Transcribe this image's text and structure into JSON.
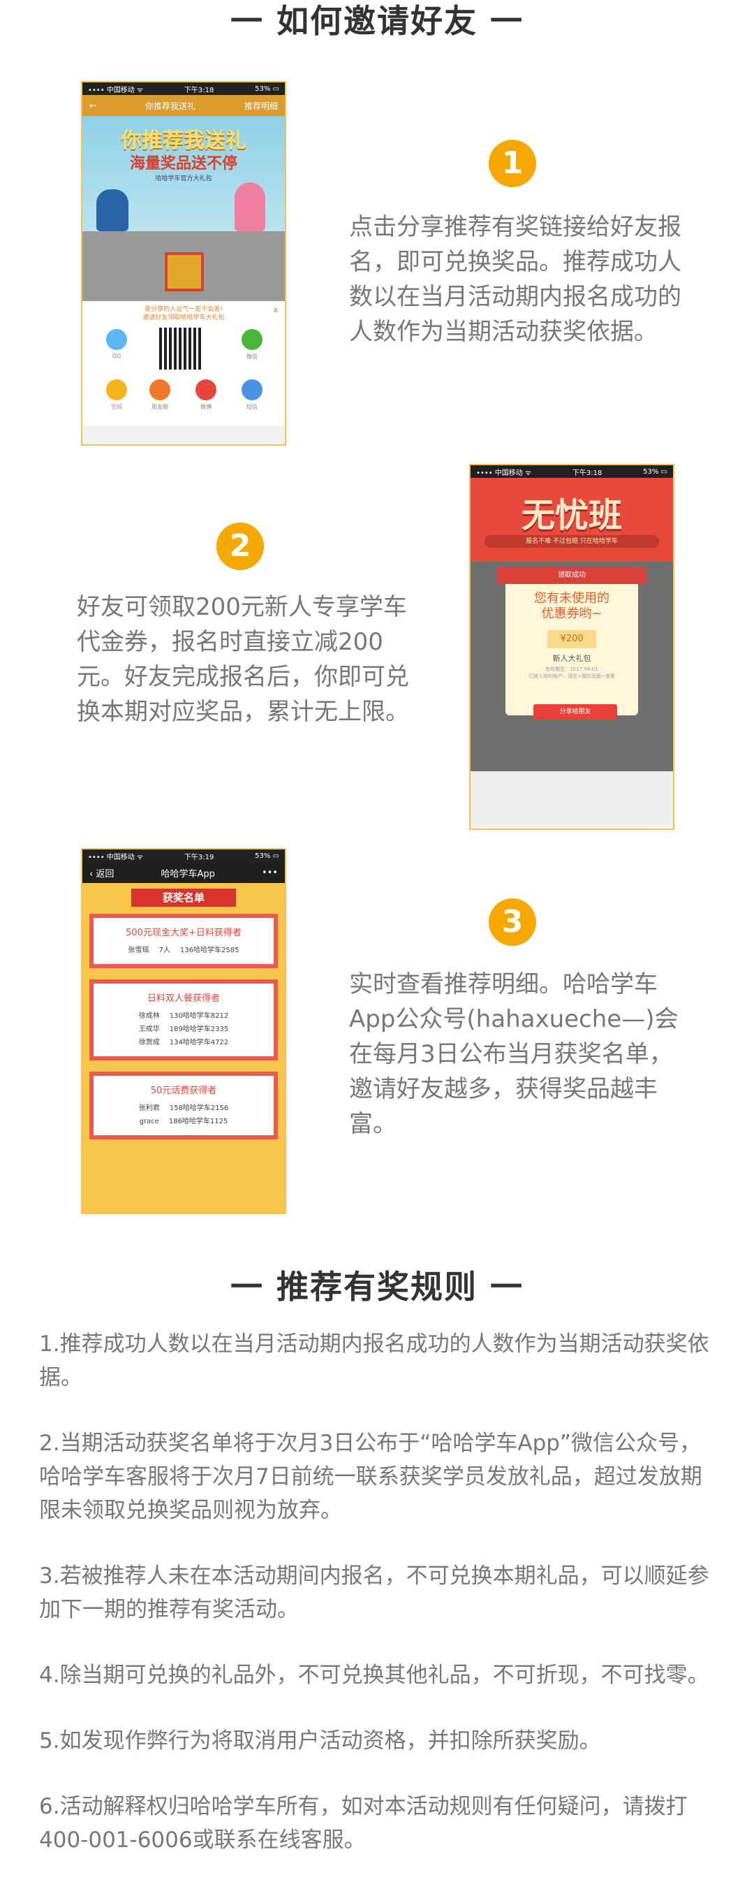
{
  "section1": {
    "title": "一 如何邀请好友 一"
  },
  "steps": [
    {
      "num": "1",
      "text": "点击分享推荐有奖链接给好友报名，即可兑换奖品。推荐成功人数以在当月活动期内报名成功的人数作为当期活动获奖依据。"
    },
    {
      "num": "2",
      "text": "好友可领取200元新人专享学车代金券，报名时直接立减200元。好友完成报名后，你即可兑换本期对应奖品，累计无上限。"
    },
    {
      "num": "3",
      "text": "实时查看推荐明细。哈哈学车App公众号(hahaxueche—)会在每月3日公布当月获奖名单，邀请好友越多，获得奖品越丰富。"
    }
  ],
  "phone1": {
    "status_left": "•••• 中国移动 ᯤ",
    "status_time": "下午3:18",
    "status_right": "53% ▭",
    "nav_back": "←",
    "nav_title": "你推荐我送礼",
    "nav_right": "推荐明细",
    "hero_title": "你推荐我送礼",
    "hero_sub": "海量奖品送不停",
    "hero_note": "哈哈学车官方大礼包",
    "share_text": "爱分享的人运气一定不会差!\n邀请好友领取哈哈学车大礼包",
    "close": "x",
    "icons": [
      {
        "label": "QQ",
        "color": "#5cb6ef"
      },
      {
        "label": "微信",
        "color": "#49b53a"
      },
      {
        "label": "空间",
        "color": "#f3b51c"
      },
      {
        "label": "朋友圈",
        "color": "#f07a2a"
      },
      {
        "label": "微博",
        "color": "#e5473d"
      },
      {
        "label": "短信",
        "color": "#4b92e3"
      }
    ]
  },
  "phone2": {
    "status_left": "•••• 中国移动 ᯤ",
    "status_time": "下午3:18",
    "status_right": "53% ▭",
    "hero_title": "无忧班",
    "hero_band": "报名不难 不过包赔 只在哈哈学车",
    "ribbon": "领取成功",
    "modal_title": "您有未使用的\n优惠券哟~",
    "coupon": "¥200",
    "pkg": "新人大礼包",
    "small": "有效期至：2017-06-01\n已放入你的账户，请在>我的页面>查看",
    "button": "分享给朋友"
  },
  "phone3": {
    "status_left": "•••• 中国移动 ᯤ",
    "status_time": "下午3:19",
    "status_right": "53% ▭",
    "nav_back": "‹ 返回",
    "nav_title": "哈哈学车App",
    "nav_more": "•••",
    "banner": "获奖名单",
    "cards": [
      {
        "title": "500元现金大奖+日料获得者",
        "rows": [
          [
            "张雪瑶",
            "7人",
            "136哈哈学车2585"
          ]
        ]
      },
      {
        "title": "日料双人餐获得者",
        "rows": [
          [
            "徐成林",
            "130哈哈学车8212"
          ],
          [
            "王成华",
            "189哈哈学车2335"
          ],
          [
            "徐贺成",
            "134哈哈学车4722"
          ]
        ]
      },
      {
        "title": "50元话费获得者",
        "rows": [
          [
            "张利君",
            "158哈哈学车2156"
          ],
          [
            "grace",
            "186哈哈学车1125"
          ]
        ]
      }
    ]
  },
  "section2": {
    "title": "一 推荐有奖规则 一"
  },
  "rules": [
    "1.推荐成功人数以在当月活动期内报名成功的人数作为当期活动获奖依据。",
    "2.当期活动获奖名单将于次月3日公布于“哈哈学车App”微信公众号，哈哈学车客服将于次月7日前统一联系获奖学员发放礼品，超过发放期限未领取兑换奖品则视为放弃。",
    "3.若被推荐人未在本活动期间内报名，不可兑换本期礼品，可以顺延参加下一期的推荐有奖活动。",
    "4.除当期可兑换的礼品外，不可兑换其他礼品，不可折现，不可找零。",
    "5.如发现作弊行为将取消用户活动资格，并扣除所获奖励。",
    "6.活动解释权归哈哈学车所有，如对本活动规则有任何疑问，请拨打400-001-6006或联系在线客服。"
  ]
}
